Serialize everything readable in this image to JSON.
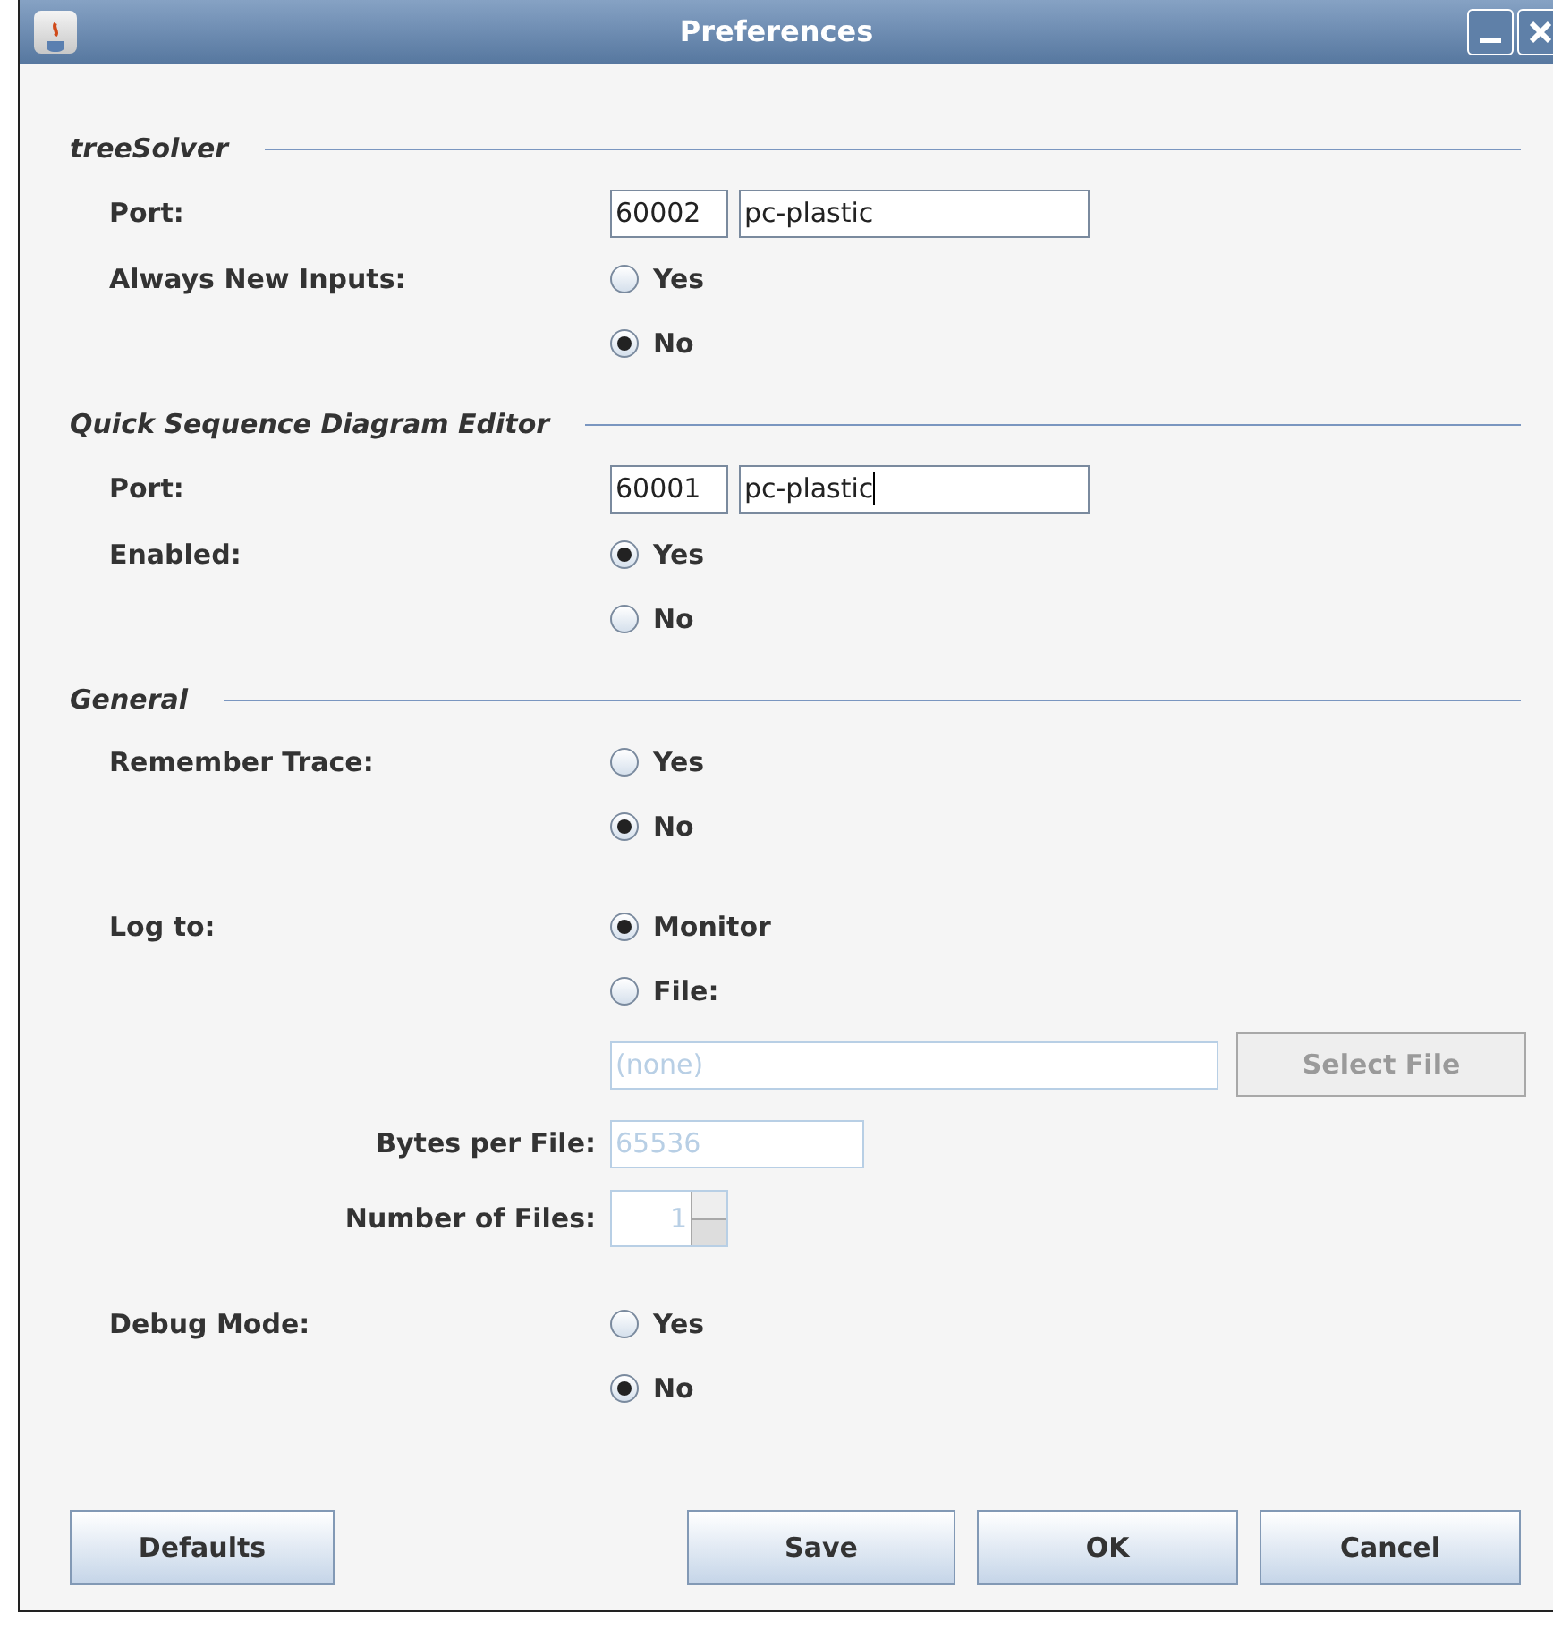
{
  "window": {
    "title": "Preferences"
  },
  "sections": [
    {
      "title": "treeSolver",
      "rows": [
        {
          "kind": "port",
          "label": "Port:",
          "port": "60002",
          "host": "pc-plastic",
          "focused": false
        },
        {
          "kind": "radio",
          "label": "Always New Inputs:",
          "options": [
            {
              "label": "Yes",
              "selected": false
            },
            {
              "label": "No",
              "selected": true
            }
          ]
        }
      ]
    },
    {
      "title": "Quick Sequence Diagram Editor",
      "rows": [
        {
          "kind": "port",
          "label": "Port:",
          "port": "60001",
          "host": "pc-plastic",
          "focused": true
        },
        {
          "kind": "radio",
          "label": "Enabled:",
          "options": [
            {
              "label": "Yes",
              "selected": true
            },
            {
              "label": "No",
              "selected": false
            }
          ]
        }
      ]
    },
    {
      "title": "General",
      "rows": [
        {
          "kind": "radio",
          "label": "Remember Trace:",
          "options": [
            {
              "label": "Yes",
              "selected": false
            },
            {
              "label": "No",
              "selected": true
            }
          ]
        },
        {
          "kind": "gap"
        },
        {
          "kind": "radio",
          "label": "Log to:",
          "options": [
            {
              "label": "Monitor",
              "selected": true
            },
            {
              "label": "File:",
              "selected": false
            }
          ]
        },
        {
          "kind": "file",
          "value": "(none)",
          "button": "Select File",
          "disabled": true
        },
        {
          "kind": "text",
          "label": "Bytes per File:",
          "value": "65536",
          "disabled": true
        },
        {
          "kind": "spinner",
          "label": "Number of Files:",
          "value": "1",
          "disabled": true
        },
        {
          "kind": "gap"
        },
        {
          "kind": "radio",
          "label": "Debug Mode:",
          "options": [
            {
              "label": "Yes",
              "selected": false
            },
            {
              "label": "No",
              "selected": true
            }
          ]
        }
      ]
    }
  ],
  "buttons": {
    "left": [
      "Defaults"
    ],
    "right": [
      "Save",
      "OK",
      "Cancel"
    ]
  }
}
